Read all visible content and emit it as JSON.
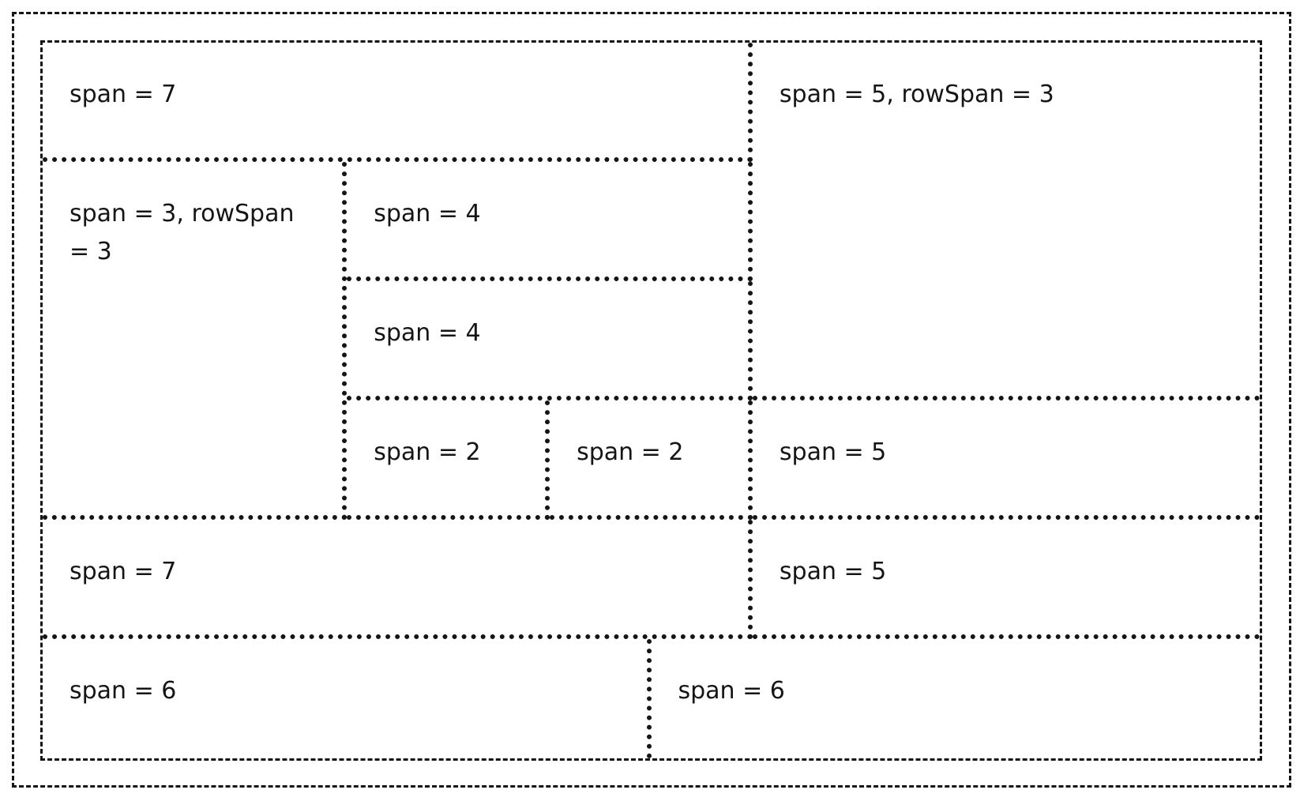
{
  "grid": {
    "items": [
      {
        "label": "span = 7"
      },
      {
        "label": "span = 5, rowSpan = 3"
      },
      {
        "label": "span = 3, rowSpan = 3"
      },
      {
        "label": "span = 4"
      },
      {
        "label": "span = 4"
      },
      {
        "label": "span = 2"
      },
      {
        "label": "span = 2"
      },
      {
        "label": "span = 5"
      },
      {
        "label": "span = 7"
      },
      {
        "label": "span = 5"
      },
      {
        "label": "span = 6"
      },
      {
        "label": "span = 6"
      }
    ]
  },
  "colors": {
    "border": "#151515",
    "text": "#151515",
    "background": "#ffffff"
  }
}
